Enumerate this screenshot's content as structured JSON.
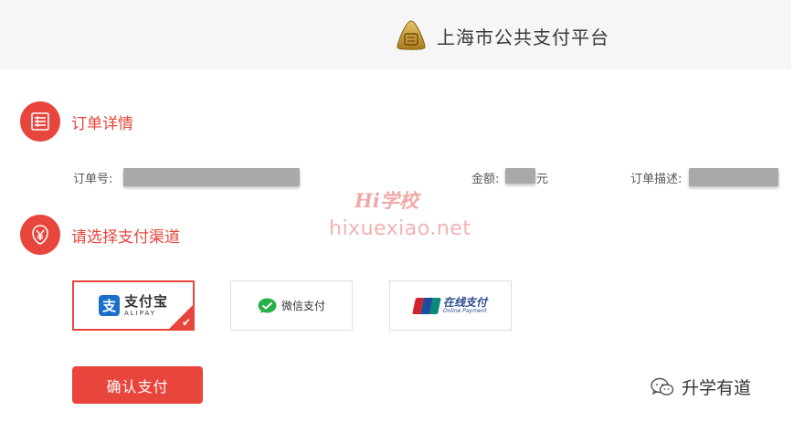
{
  "header": {
    "title": "上海市公共支付平台"
  },
  "order_section": {
    "title": "订单详情",
    "order_no_label": "订单号:",
    "amount_label": "金额:",
    "amount_unit": "元",
    "desc_label": "订单描述:"
  },
  "watermark": {
    "hi": "Hi学校",
    "domain": "hixuexiao.net"
  },
  "pay_section": {
    "title": "请选择支付渠道",
    "options": [
      {
        "name_cn": "支付宝",
        "name_en": "ALIPAY",
        "selected": true
      },
      {
        "name_cn": "微信支付",
        "selected": false
      },
      {
        "name_cn": "在线支付",
        "name_en": "Online Payment",
        "badge": "UnionPay 银联",
        "selected": false
      }
    ]
  },
  "confirm_label": "确认支付",
  "brand_watermark": "升学有道",
  "colors": {
    "accent": "#e8453c",
    "header_bg": "#f6f6f7",
    "alipay_blue": "#1a6fc9",
    "wechat_green": "#2ab049",
    "redaction": "#a9a9a9"
  },
  "icons": {
    "logo": "platform-seal-icon",
    "order": "list-icon",
    "pay": "yen-icon",
    "check": "check-icon"
  }
}
